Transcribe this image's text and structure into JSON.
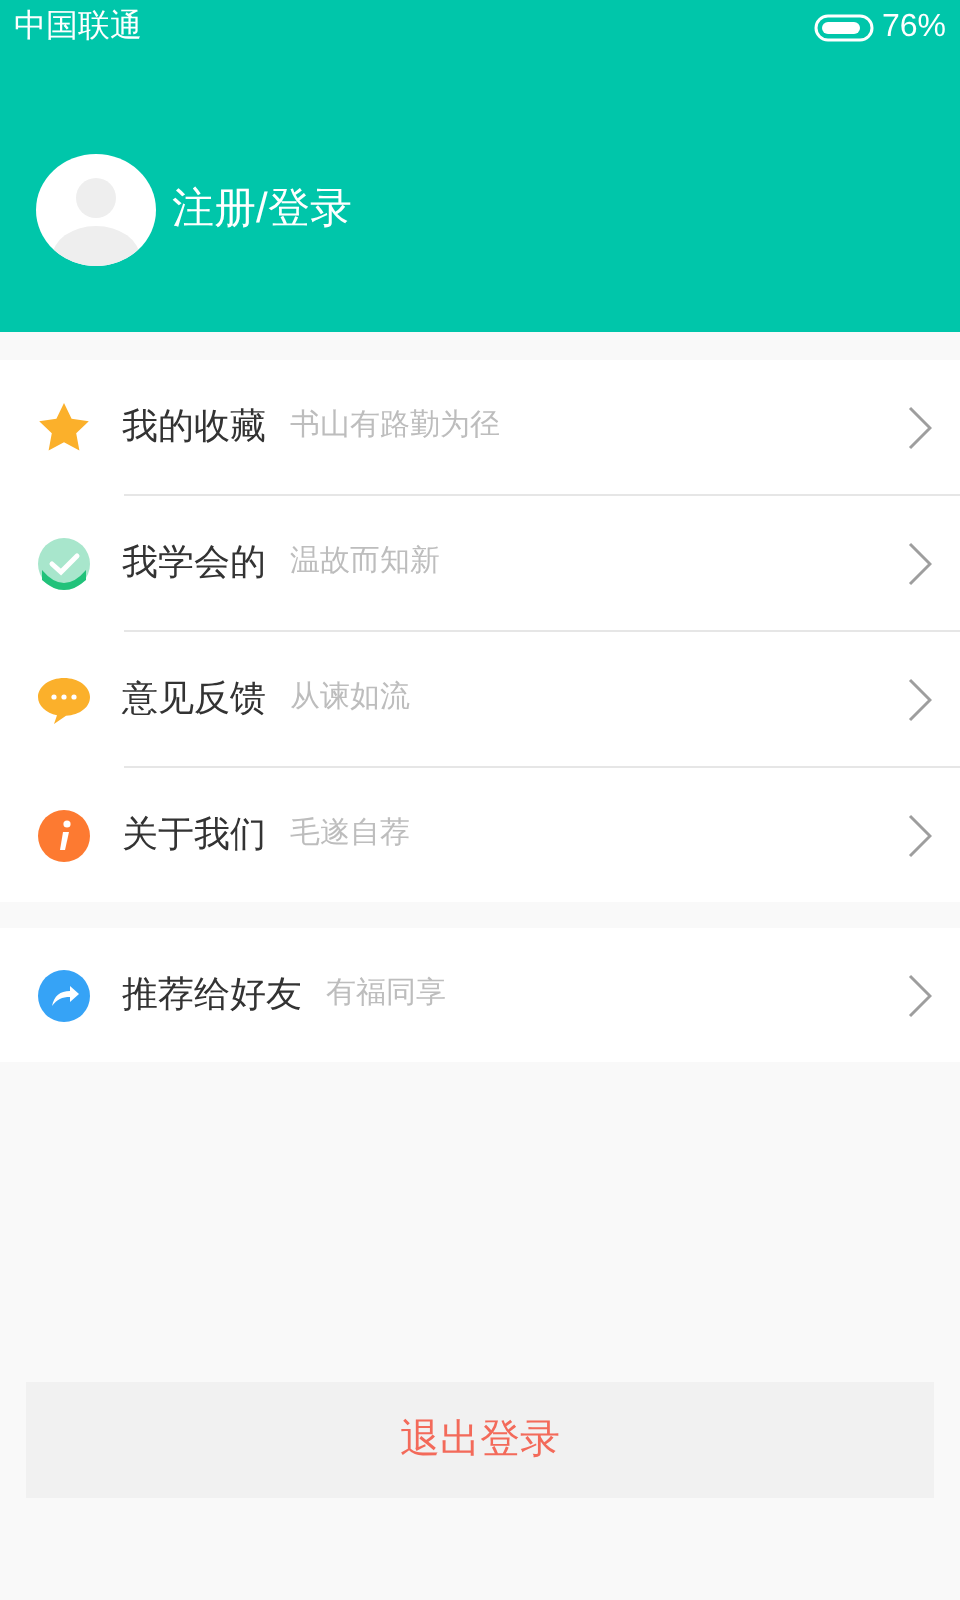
{
  "status_bar": {
    "carrier": "中国联通",
    "battery_text": "76%"
  },
  "profile": {
    "login_label": "注册/登录"
  },
  "menu_groups": [
    {
      "items": [
        {
          "kind": "star",
          "title": "我的收藏",
          "subtitle": "书山有路勤为径"
        },
        {
          "kind": "check",
          "title": "我学会的",
          "subtitle": "温故而知新"
        },
        {
          "kind": "chat",
          "title": "意见反馈",
          "subtitle": "从谏如流"
        },
        {
          "kind": "info",
          "title": "关于我们",
          "subtitle": "毛遂自荐"
        }
      ]
    },
    {
      "items": [
        {
          "kind": "share",
          "title": "推荐给好友",
          "subtitle": "有福同享"
        }
      ]
    }
  ],
  "logout_button": "退出登录"
}
